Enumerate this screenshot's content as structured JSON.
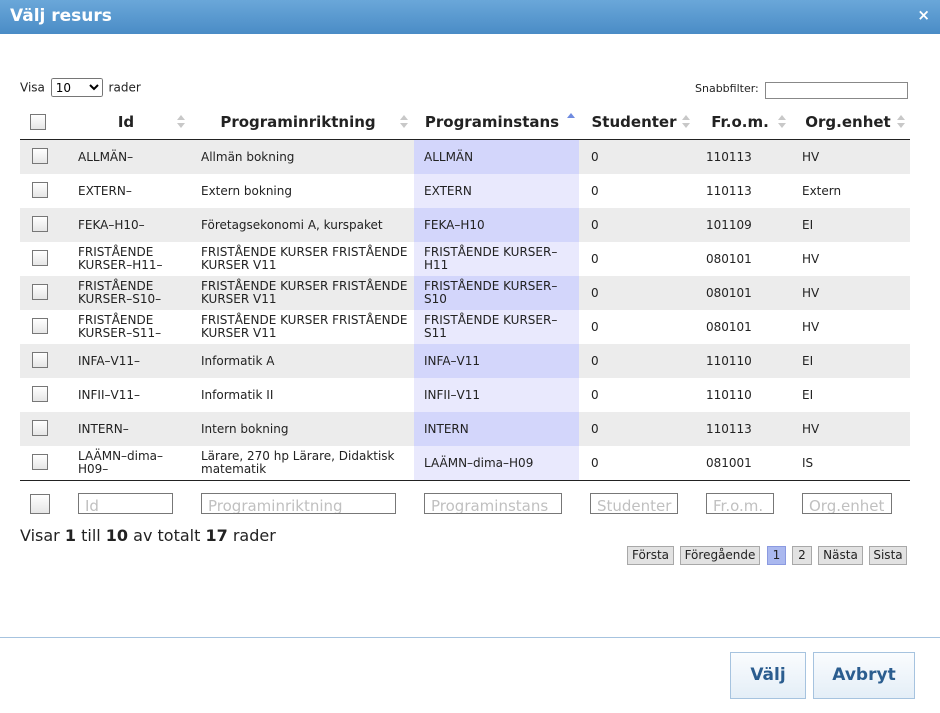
{
  "dialog": {
    "title": "Välj resurs",
    "close_symbol": "×"
  },
  "length_control": {
    "prefix": "Visa",
    "value": "10",
    "suffix": "rader"
  },
  "quick_filter": {
    "label": "Snabbfilter:",
    "value": ""
  },
  "columns": [
    {
      "key": "id",
      "label": "Id"
    },
    {
      "key": "programinriktning",
      "label": "Programinriktning"
    },
    {
      "key": "programinstans",
      "label": "Programinstans",
      "sorted": "asc"
    },
    {
      "key": "studenter",
      "label": "Studenter"
    },
    {
      "key": "from",
      "label": "Fr.o.m."
    },
    {
      "key": "orgenhet",
      "label": "Org.enhet"
    }
  ],
  "rows": [
    {
      "id": "ALLMÄN–",
      "programinriktning": "Allmän bokning",
      "programinstans": "ALLMÄN",
      "studenter": "0",
      "from": "110113",
      "orgenhet": "HV"
    },
    {
      "id": "EXTERN–",
      "programinriktning": "Extern bokning",
      "programinstans": "EXTERN",
      "studenter": "0",
      "from": "110113",
      "orgenhet": "Extern"
    },
    {
      "id": "FEKA–H10–",
      "programinriktning": "Företagsekonomi A, kurspaket",
      "programinstans": "FEKA–H10",
      "studenter": "0",
      "from": "101109",
      "orgenhet": "EI"
    },
    {
      "id": "FRISTÅENDE KURSER–H11–",
      "programinriktning": "FRISTÅENDE KURSER FRISTÅENDE KURSER V11",
      "programinstans": "FRISTÅENDE KURSER–H11",
      "studenter": "0",
      "from": "080101",
      "orgenhet": "HV"
    },
    {
      "id": "FRISTÅENDE KURSER–S10–",
      "programinriktning": "FRISTÅENDE KURSER FRISTÅENDE KURSER V11",
      "programinstans": "FRISTÅENDE KURSER–S10",
      "studenter": "0",
      "from": "080101",
      "orgenhet": "HV"
    },
    {
      "id": "FRISTÅENDE KURSER–S11–",
      "programinriktning": "FRISTÅENDE KURSER FRISTÅENDE KURSER V11",
      "programinstans": "FRISTÅENDE KURSER–S11",
      "studenter": "0",
      "from": "080101",
      "orgenhet": "HV"
    },
    {
      "id": "INFA–V11–",
      "programinriktning": "Informatik A",
      "programinstans": "INFA–V11",
      "studenter": "0",
      "from": "110110",
      "orgenhet": "EI"
    },
    {
      "id": "INFII–V11–",
      "programinriktning": "Informatik II",
      "programinstans": "INFII–V11",
      "studenter": "0",
      "from": "110110",
      "orgenhet": "EI"
    },
    {
      "id": "INTERN–",
      "programinriktning": "Intern bokning",
      "programinstans": "INTERN",
      "studenter": "0",
      "from": "110113",
      "orgenhet": "HV"
    },
    {
      "id": "LAÄMN–dima–H09–",
      "programinriktning": "Lärare, 270 hp Lärare, Didaktisk matematik",
      "programinstans": "LAÄMN–dima–H09",
      "studenter": "0",
      "from": "081001",
      "orgenhet": "IS"
    }
  ],
  "filters": {
    "id": "Id",
    "programinriktning": "Programinriktning",
    "programinstans": "Programinstans",
    "studenter": "Studenter",
    "from": "Fr.o.m.",
    "orgenhet": "Org.enhet"
  },
  "info": {
    "w1": "Visar",
    "start": "1",
    "w2": "till",
    "end": "10",
    "w3": "av totalt",
    "total": "17",
    "w4": "rader"
  },
  "pagination": {
    "first": "Första",
    "prev": "Föregående",
    "page1": "1",
    "page2": "2",
    "next": "Nästa",
    "last": "Sista",
    "current": "1"
  },
  "buttons": {
    "select": "Välj",
    "cancel": "Avbryt"
  }
}
